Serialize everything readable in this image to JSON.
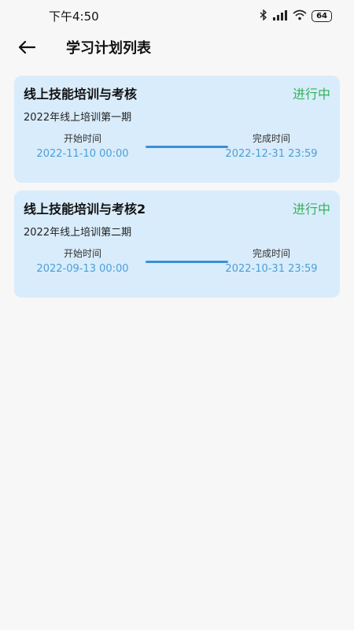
{
  "status": {
    "time": "下午4:50",
    "battery": "64"
  },
  "header": {
    "title": "学习计划列表"
  },
  "plans": [
    {
      "title": "线上技能培训与考核",
      "status": "进行中",
      "subtitle": "2022年线上培训第一期",
      "start_label": "开始时间",
      "start_value": "2022-11-10 00:00",
      "end_label": "完成时间",
      "end_value": "2022-12-31 23:59"
    },
    {
      "title": "线上技能培训与考核2",
      "status": "进行中",
      "subtitle": "2022年线上培训第二期",
      "start_label": "开始时间",
      "start_value": "2022-09-13 00:00",
      "end_label": "完成时间",
      "end_value": "2022-10-31 23:59"
    }
  ],
  "colors": {
    "card_bg": "#d9ecfb",
    "status_green": "#33b35a",
    "time_blue": "#4a9fd8",
    "bar_blue": "#3a8fd8"
  }
}
